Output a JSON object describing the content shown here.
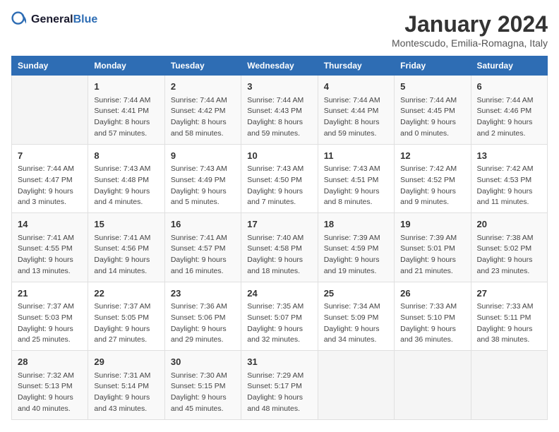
{
  "header": {
    "logo_line1": "General",
    "logo_line2": "Blue",
    "month": "January 2024",
    "location": "Montescudo, Emilia-Romagna, Italy"
  },
  "days_of_week": [
    "Sunday",
    "Monday",
    "Tuesday",
    "Wednesday",
    "Thursday",
    "Friday",
    "Saturday"
  ],
  "weeks": [
    [
      {
        "day": "",
        "content": ""
      },
      {
        "day": "1",
        "content": "Sunrise: 7:44 AM\nSunset: 4:41 PM\nDaylight: 8 hours\nand 57 minutes."
      },
      {
        "day": "2",
        "content": "Sunrise: 7:44 AM\nSunset: 4:42 PM\nDaylight: 8 hours\nand 58 minutes."
      },
      {
        "day": "3",
        "content": "Sunrise: 7:44 AM\nSunset: 4:43 PM\nDaylight: 8 hours\nand 59 minutes."
      },
      {
        "day": "4",
        "content": "Sunrise: 7:44 AM\nSunset: 4:44 PM\nDaylight: 8 hours\nand 59 minutes."
      },
      {
        "day": "5",
        "content": "Sunrise: 7:44 AM\nSunset: 4:45 PM\nDaylight: 9 hours\nand 0 minutes."
      },
      {
        "day": "6",
        "content": "Sunrise: 7:44 AM\nSunset: 4:46 PM\nDaylight: 9 hours\nand 2 minutes."
      }
    ],
    [
      {
        "day": "7",
        "content": "Sunrise: 7:44 AM\nSunset: 4:47 PM\nDaylight: 9 hours\nand 3 minutes."
      },
      {
        "day": "8",
        "content": "Sunrise: 7:43 AM\nSunset: 4:48 PM\nDaylight: 9 hours\nand 4 minutes."
      },
      {
        "day": "9",
        "content": "Sunrise: 7:43 AM\nSunset: 4:49 PM\nDaylight: 9 hours\nand 5 minutes."
      },
      {
        "day": "10",
        "content": "Sunrise: 7:43 AM\nSunset: 4:50 PM\nDaylight: 9 hours\nand 7 minutes."
      },
      {
        "day": "11",
        "content": "Sunrise: 7:43 AM\nSunset: 4:51 PM\nDaylight: 9 hours\nand 8 minutes."
      },
      {
        "day": "12",
        "content": "Sunrise: 7:42 AM\nSunset: 4:52 PM\nDaylight: 9 hours\nand 9 minutes."
      },
      {
        "day": "13",
        "content": "Sunrise: 7:42 AM\nSunset: 4:53 PM\nDaylight: 9 hours\nand 11 minutes."
      }
    ],
    [
      {
        "day": "14",
        "content": "Sunrise: 7:41 AM\nSunset: 4:55 PM\nDaylight: 9 hours\nand 13 minutes."
      },
      {
        "day": "15",
        "content": "Sunrise: 7:41 AM\nSunset: 4:56 PM\nDaylight: 9 hours\nand 14 minutes."
      },
      {
        "day": "16",
        "content": "Sunrise: 7:41 AM\nSunset: 4:57 PM\nDaylight: 9 hours\nand 16 minutes."
      },
      {
        "day": "17",
        "content": "Sunrise: 7:40 AM\nSunset: 4:58 PM\nDaylight: 9 hours\nand 18 minutes."
      },
      {
        "day": "18",
        "content": "Sunrise: 7:39 AM\nSunset: 4:59 PM\nDaylight: 9 hours\nand 19 minutes."
      },
      {
        "day": "19",
        "content": "Sunrise: 7:39 AM\nSunset: 5:01 PM\nDaylight: 9 hours\nand 21 minutes."
      },
      {
        "day": "20",
        "content": "Sunrise: 7:38 AM\nSunset: 5:02 PM\nDaylight: 9 hours\nand 23 minutes."
      }
    ],
    [
      {
        "day": "21",
        "content": "Sunrise: 7:37 AM\nSunset: 5:03 PM\nDaylight: 9 hours\nand 25 minutes."
      },
      {
        "day": "22",
        "content": "Sunrise: 7:37 AM\nSunset: 5:05 PM\nDaylight: 9 hours\nand 27 minutes."
      },
      {
        "day": "23",
        "content": "Sunrise: 7:36 AM\nSunset: 5:06 PM\nDaylight: 9 hours\nand 29 minutes."
      },
      {
        "day": "24",
        "content": "Sunrise: 7:35 AM\nSunset: 5:07 PM\nDaylight: 9 hours\nand 32 minutes."
      },
      {
        "day": "25",
        "content": "Sunrise: 7:34 AM\nSunset: 5:09 PM\nDaylight: 9 hours\nand 34 minutes."
      },
      {
        "day": "26",
        "content": "Sunrise: 7:33 AM\nSunset: 5:10 PM\nDaylight: 9 hours\nand 36 minutes."
      },
      {
        "day": "27",
        "content": "Sunrise: 7:33 AM\nSunset: 5:11 PM\nDaylight: 9 hours\nand 38 minutes."
      }
    ],
    [
      {
        "day": "28",
        "content": "Sunrise: 7:32 AM\nSunset: 5:13 PM\nDaylight: 9 hours\nand 40 minutes."
      },
      {
        "day": "29",
        "content": "Sunrise: 7:31 AM\nSunset: 5:14 PM\nDaylight: 9 hours\nand 43 minutes."
      },
      {
        "day": "30",
        "content": "Sunrise: 7:30 AM\nSunset: 5:15 PM\nDaylight: 9 hours\nand 45 minutes."
      },
      {
        "day": "31",
        "content": "Sunrise: 7:29 AM\nSunset: 5:17 PM\nDaylight: 9 hours\nand 48 minutes."
      },
      {
        "day": "",
        "content": ""
      },
      {
        "day": "",
        "content": ""
      },
      {
        "day": "",
        "content": ""
      }
    ]
  ]
}
